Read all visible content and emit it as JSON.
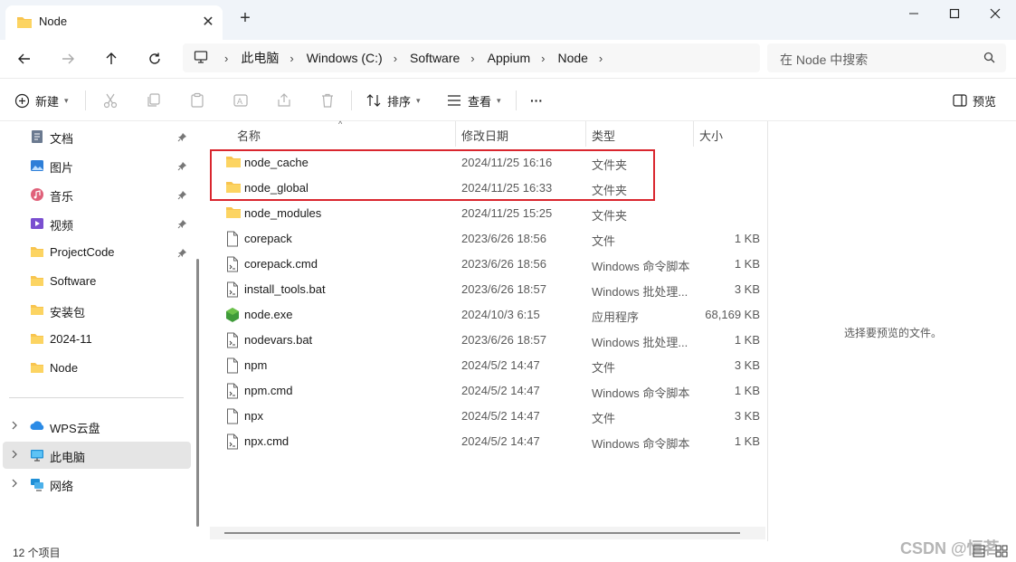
{
  "window": {
    "tab_title": "Node",
    "new_tab": "+"
  },
  "address": {
    "crumbs": [
      "此电脑",
      "Windows (C:)",
      "Software",
      "Appium",
      "Node"
    ]
  },
  "search": {
    "placeholder": "在 Node 中搜索"
  },
  "toolbar": {
    "new_label": "新建",
    "sort_label": "排序",
    "view_label": "查看",
    "more_label": "···",
    "preview_label": "预览"
  },
  "sidebar": {
    "pinned": [
      {
        "label": "文档",
        "icon": "document-icon"
      },
      {
        "label": "图片",
        "icon": "pictures-icon"
      },
      {
        "label": "音乐",
        "icon": "music-icon"
      },
      {
        "label": "视频",
        "icon": "video-icon"
      },
      {
        "label": "ProjectCode",
        "icon": "folder-icon"
      }
    ],
    "folders": [
      "Software",
      "安装包",
      "2024-11",
      "Node"
    ],
    "roots": [
      {
        "label": "WPS云盘",
        "icon": "cloud-icon"
      },
      {
        "label": "此电脑",
        "icon": "computer-icon",
        "selected": true
      },
      {
        "label": "网络",
        "icon": "network-icon"
      }
    ]
  },
  "columns": {
    "name": "名称",
    "date": "修改日期",
    "type": "类型",
    "size": "大小"
  },
  "files": [
    {
      "name": "node_cache",
      "date": "2024/11/25 16:16",
      "type": "文件夹",
      "size": "",
      "icon": "folder"
    },
    {
      "name": "node_global",
      "date": "2024/11/25 16:33",
      "type": "文件夹",
      "size": "",
      "icon": "folder"
    },
    {
      "name": "node_modules",
      "date": "2024/11/25 15:25",
      "type": "文件夹",
      "size": "",
      "icon": "folder"
    },
    {
      "name": "corepack",
      "date": "2023/6/26 18:56",
      "type": "文件",
      "size": "1 KB",
      "icon": "file"
    },
    {
      "name": "corepack.cmd",
      "date": "2023/6/26 18:56",
      "type": "Windows 命令脚本",
      "size": "1 KB",
      "icon": "script"
    },
    {
      "name": "install_tools.bat",
      "date": "2023/6/26 18:57",
      "type": "Windows 批处理...",
      "size": "3 KB",
      "icon": "script"
    },
    {
      "name": "node.exe",
      "date": "2024/10/3 6:15",
      "type": "应用程序",
      "size": "68,169 KB",
      "icon": "node"
    },
    {
      "name": "nodevars.bat",
      "date": "2023/6/26 18:57",
      "type": "Windows 批处理...",
      "size": "1 KB",
      "icon": "script"
    },
    {
      "name": "npm",
      "date": "2024/5/2 14:47",
      "type": "文件",
      "size": "3 KB",
      "icon": "file"
    },
    {
      "name": "npm.cmd",
      "date": "2024/5/2 14:47",
      "type": "Windows 命令脚本",
      "size": "1 KB",
      "icon": "script"
    },
    {
      "name": "npx",
      "date": "2024/5/2 14:47",
      "type": "文件",
      "size": "3 KB",
      "icon": "file"
    },
    {
      "name": "npx.cmd",
      "date": "2024/5/2 14:47",
      "type": "Windows 命令脚本",
      "size": "1 KB",
      "icon": "script"
    }
  ],
  "preview": {
    "message": "选择要预览的文件。"
  },
  "status": {
    "count": "12 个项目"
  },
  "watermark": "CSDN @恒茗",
  "colors": {
    "accent": "#0067c0",
    "folder": "#f8c44f",
    "highlight": "#d9262e",
    "selected": "#e5e5e5"
  }
}
